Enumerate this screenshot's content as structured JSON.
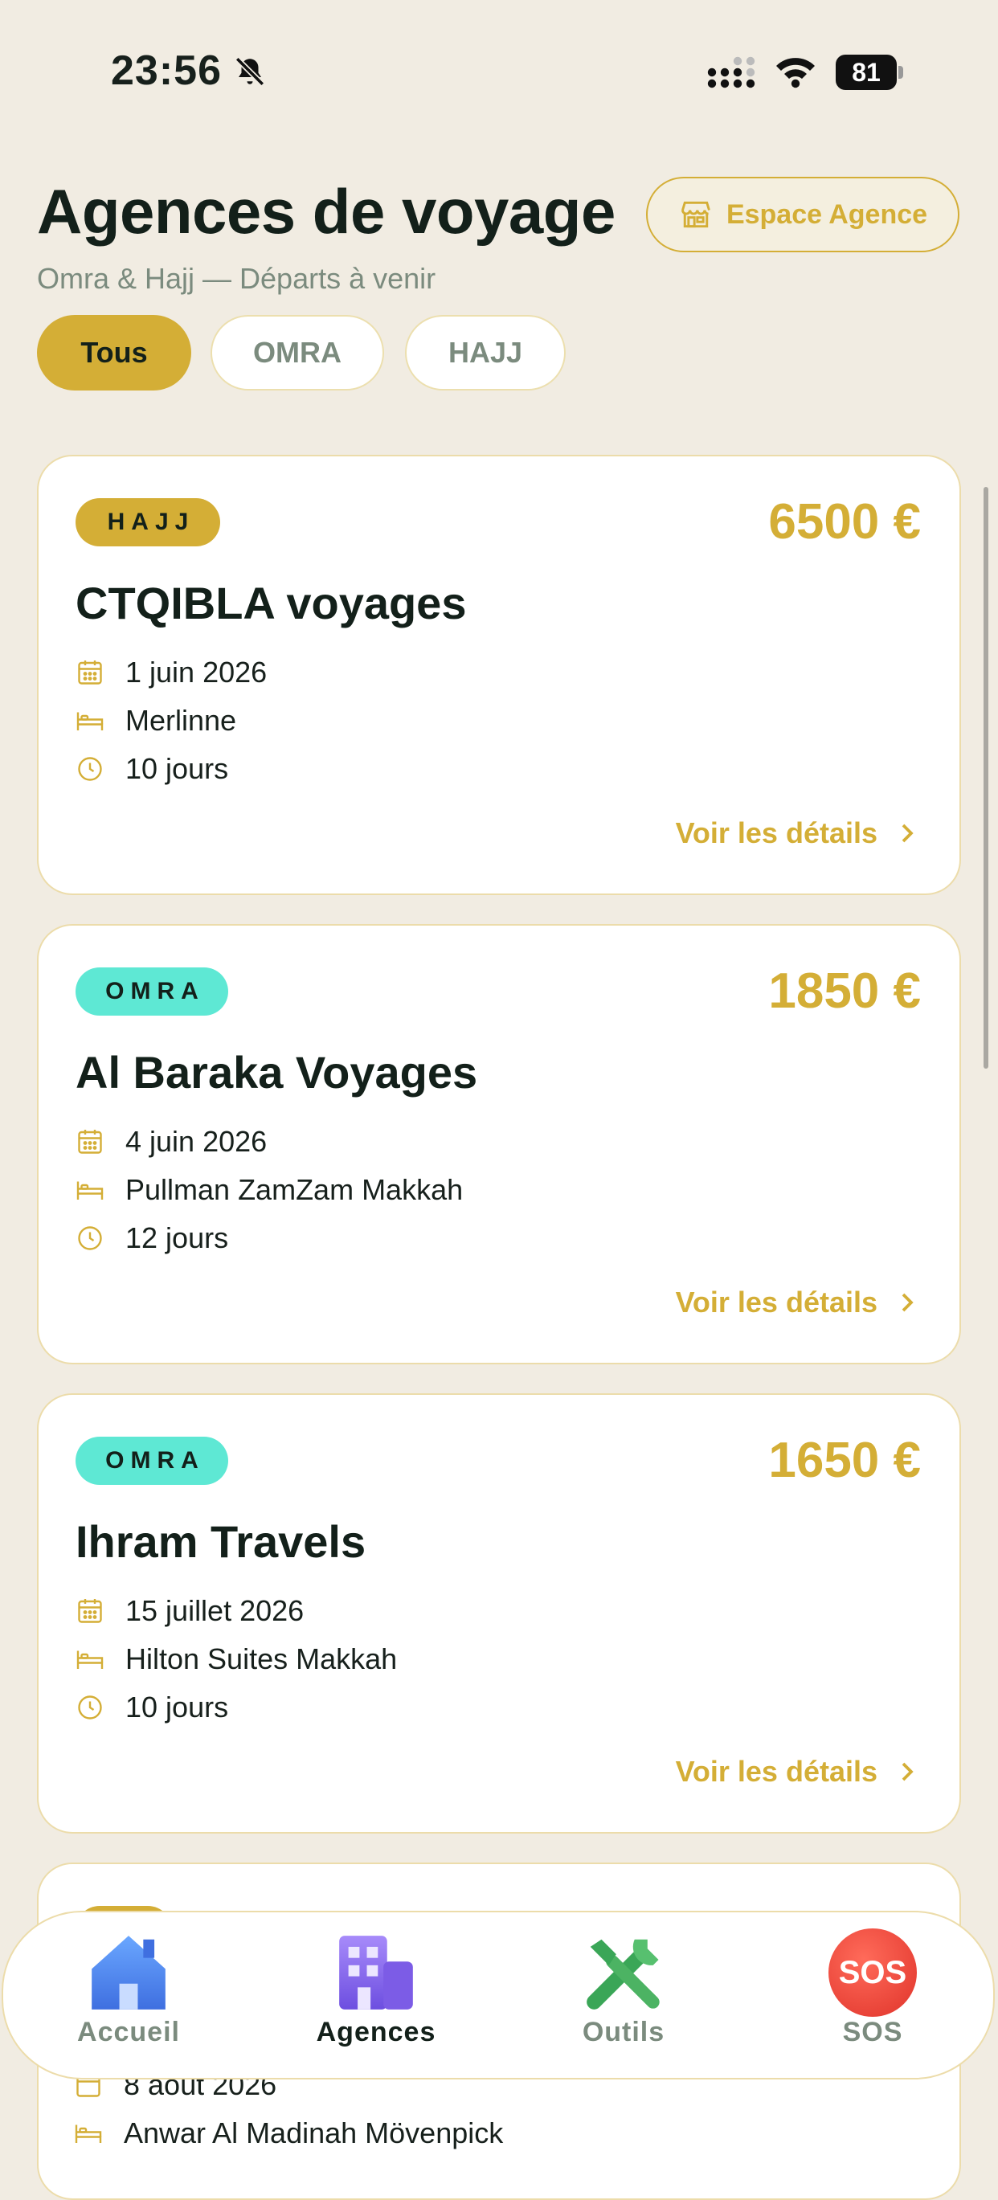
{
  "status": {
    "time": "23:56",
    "battery": "81"
  },
  "header": {
    "title": "Agences de voyage",
    "subtitle": "Omra & Hajj — Départs à venir",
    "agency_button": "Espace Agence"
  },
  "filters": {
    "all": "Tous",
    "omra": "OMRA",
    "hajj": "HAJJ",
    "selected": "Tous"
  },
  "cards": [
    {
      "badge": "HAJJ",
      "price": "6500 €",
      "name": "CTQIBLA voyages",
      "date": "1 juin 2026",
      "hotel": "Merlinne",
      "duration": "10 jours",
      "link": "Voir les détails"
    },
    {
      "badge": "OMRA",
      "price": "1850 €",
      "name": "Al Baraka Voyages",
      "date": "4 juin 2026",
      "hotel": "Pullman ZamZam Makkah",
      "duration": "12 jours",
      "link": "Voir les détails"
    },
    {
      "badge": "OMRA",
      "price": "1650 €",
      "name": "Ihram Travels",
      "date": "15 juillet 2026",
      "hotel": "Hilton Suites Makkah",
      "duration": "10 jours",
      "link": "Voir les détails"
    },
    {
      "date": "8 août 2026",
      "hotel": "Anwar Al Madinah Mövenpick"
    }
  ],
  "nav": {
    "home": "Accueil",
    "agencies": "Agences",
    "tools": "Outils",
    "sos": "SOS",
    "sos_icon_text": "SOS",
    "active": "Agences"
  },
  "colors": {
    "gold": "#d4ae36",
    "teal": "#5ee8d4",
    "background": "#f1ece2",
    "text_dark": "#13201a",
    "muted": "#7b8b7e"
  }
}
